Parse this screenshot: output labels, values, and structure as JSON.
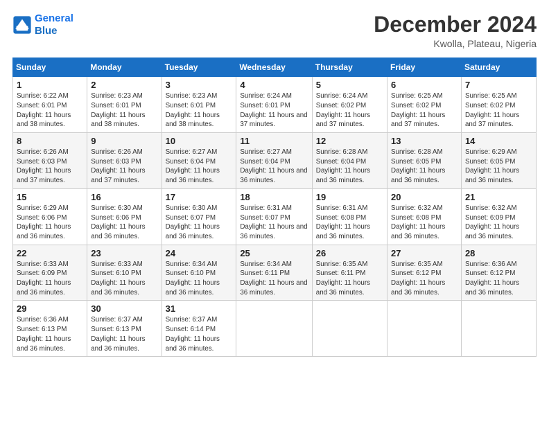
{
  "logo": {
    "line1": "General",
    "line2": "Blue"
  },
  "title": "December 2024",
  "location": "Kwolla, Plateau, Nigeria",
  "days_of_week": [
    "Sunday",
    "Monday",
    "Tuesday",
    "Wednesday",
    "Thursday",
    "Friday",
    "Saturday"
  ],
  "weeks": [
    [
      {
        "day": "1",
        "sunrise": "6:22 AM",
        "sunset": "6:01 PM",
        "daylight": "11 hours and 38 minutes."
      },
      {
        "day": "2",
        "sunrise": "6:23 AM",
        "sunset": "6:01 PM",
        "daylight": "11 hours and 38 minutes."
      },
      {
        "day": "3",
        "sunrise": "6:23 AM",
        "sunset": "6:01 PM",
        "daylight": "11 hours and 38 minutes."
      },
      {
        "day": "4",
        "sunrise": "6:24 AM",
        "sunset": "6:01 PM",
        "daylight": "11 hours and 37 minutes."
      },
      {
        "day": "5",
        "sunrise": "6:24 AM",
        "sunset": "6:02 PM",
        "daylight": "11 hours and 37 minutes."
      },
      {
        "day": "6",
        "sunrise": "6:25 AM",
        "sunset": "6:02 PM",
        "daylight": "11 hours and 37 minutes."
      },
      {
        "day": "7",
        "sunrise": "6:25 AM",
        "sunset": "6:02 PM",
        "daylight": "11 hours and 37 minutes."
      }
    ],
    [
      {
        "day": "8",
        "sunrise": "6:26 AM",
        "sunset": "6:03 PM",
        "daylight": "11 hours and 37 minutes."
      },
      {
        "day": "9",
        "sunrise": "6:26 AM",
        "sunset": "6:03 PM",
        "daylight": "11 hours and 37 minutes."
      },
      {
        "day": "10",
        "sunrise": "6:27 AM",
        "sunset": "6:04 PM",
        "daylight": "11 hours and 36 minutes."
      },
      {
        "day": "11",
        "sunrise": "6:27 AM",
        "sunset": "6:04 PM",
        "daylight": "11 hours and 36 minutes."
      },
      {
        "day": "12",
        "sunrise": "6:28 AM",
        "sunset": "6:04 PM",
        "daylight": "11 hours and 36 minutes."
      },
      {
        "day": "13",
        "sunrise": "6:28 AM",
        "sunset": "6:05 PM",
        "daylight": "11 hours and 36 minutes."
      },
      {
        "day": "14",
        "sunrise": "6:29 AM",
        "sunset": "6:05 PM",
        "daylight": "11 hours and 36 minutes."
      }
    ],
    [
      {
        "day": "15",
        "sunrise": "6:29 AM",
        "sunset": "6:06 PM",
        "daylight": "11 hours and 36 minutes."
      },
      {
        "day": "16",
        "sunrise": "6:30 AM",
        "sunset": "6:06 PM",
        "daylight": "11 hours and 36 minutes."
      },
      {
        "day": "17",
        "sunrise": "6:30 AM",
        "sunset": "6:07 PM",
        "daylight": "11 hours and 36 minutes."
      },
      {
        "day": "18",
        "sunrise": "6:31 AM",
        "sunset": "6:07 PM",
        "daylight": "11 hours and 36 minutes."
      },
      {
        "day": "19",
        "sunrise": "6:31 AM",
        "sunset": "6:08 PM",
        "daylight": "11 hours and 36 minutes."
      },
      {
        "day": "20",
        "sunrise": "6:32 AM",
        "sunset": "6:08 PM",
        "daylight": "11 hours and 36 minutes."
      },
      {
        "day": "21",
        "sunrise": "6:32 AM",
        "sunset": "6:09 PM",
        "daylight": "11 hours and 36 minutes."
      }
    ],
    [
      {
        "day": "22",
        "sunrise": "6:33 AM",
        "sunset": "6:09 PM",
        "daylight": "11 hours and 36 minutes."
      },
      {
        "day": "23",
        "sunrise": "6:33 AM",
        "sunset": "6:10 PM",
        "daylight": "11 hours and 36 minutes."
      },
      {
        "day": "24",
        "sunrise": "6:34 AM",
        "sunset": "6:10 PM",
        "daylight": "11 hours and 36 minutes."
      },
      {
        "day": "25",
        "sunrise": "6:34 AM",
        "sunset": "6:11 PM",
        "daylight": "11 hours and 36 minutes."
      },
      {
        "day": "26",
        "sunrise": "6:35 AM",
        "sunset": "6:11 PM",
        "daylight": "11 hours and 36 minutes."
      },
      {
        "day": "27",
        "sunrise": "6:35 AM",
        "sunset": "6:12 PM",
        "daylight": "11 hours and 36 minutes."
      },
      {
        "day": "28",
        "sunrise": "6:36 AM",
        "sunset": "6:12 PM",
        "daylight": "11 hours and 36 minutes."
      }
    ],
    [
      {
        "day": "29",
        "sunrise": "6:36 AM",
        "sunset": "6:13 PM",
        "daylight": "11 hours and 36 minutes."
      },
      {
        "day": "30",
        "sunrise": "6:37 AM",
        "sunset": "6:13 PM",
        "daylight": "11 hours and 36 minutes."
      },
      {
        "day": "31",
        "sunrise": "6:37 AM",
        "sunset": "6:14 PM",
        "daylight": "11 hours and 36 minutes."
      },
      null,
      null,
      null,
      null
    ]
  ]
}
